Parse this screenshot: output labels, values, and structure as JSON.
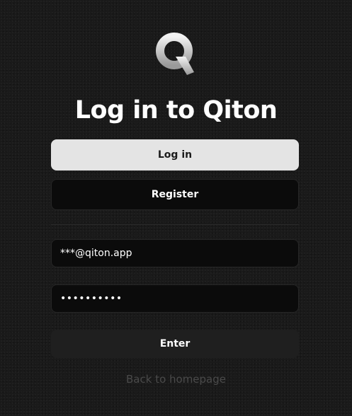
{
  "brand": {
    "logo_icon": "qiton-q-logo-icon",
    "accent_color": "#e4e4e4"
  },
  "page": {
    "title": "Log in to Qiton"
  },
  "auth_tabs": {
    "login_label": "Log in",
    "register_label": "Register"
  },
  "form": {
    "email_value": "***@qiton.app",
    "password_value": "••••••••••",
    "submit_label": "Enter"
  },
  "footer": {
    "back_link_label": "Back to homepage"
  }
}
